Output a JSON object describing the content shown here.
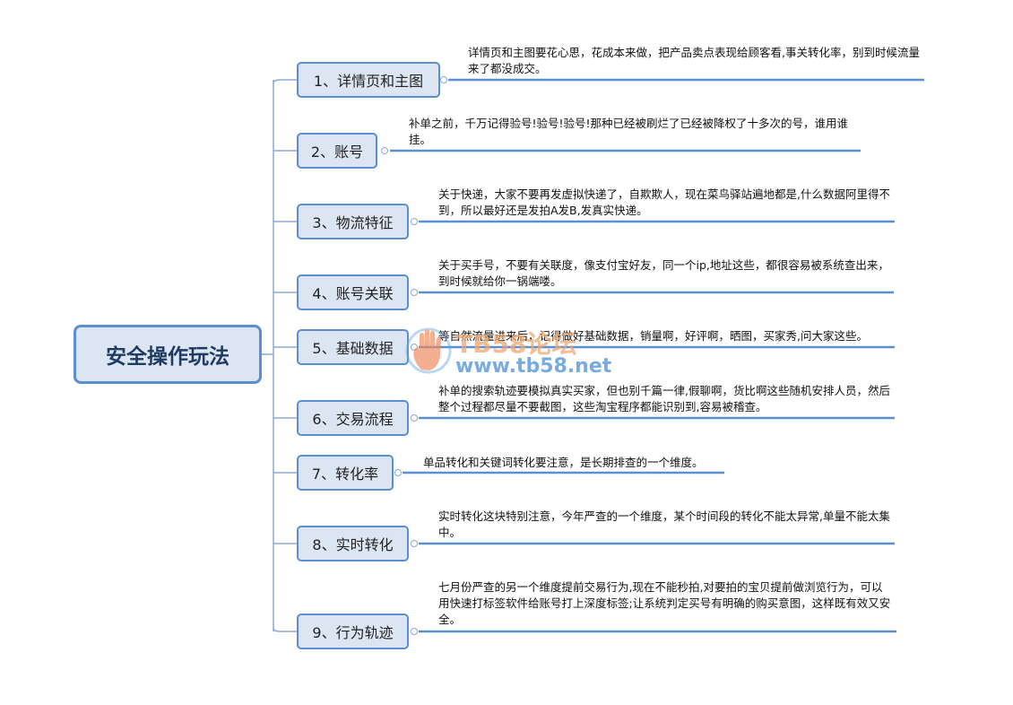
{
  "root": {
    "label": "安全操作玩法"
  },
  "branches": [
    {
      "label": "1、详情页和主图",
      "note": "详情页和主图要花心思，花成本来做，把产品卖点表现给顾客看,事关转化率，别到时候流量来了都没成交。"
    },
    {
      "label": "2、账号",
      "note": "补单之前，千万记得验号!验号!验号!那种已经被刷烂了已经被降权了十多次的号，谁用谁挂。"
    },
    {
      "label": "3、物流特征",
      "note": "关于快递，大家不要再发虚拟快递了，自欺欺人，现在菜鸟驿站遍地都是,什么数据阿里得不到，所以最好还是发拍A发B,发真实快递。"
    },
    {
      "label": "4、账号关联",
      "note": "关于买手号，不要有关联度，像支付宝好友，同一个ip,地址这些，都很容易被系统查出来，到时候就给你一锅端喽。"
    },
    {
      "label": "5、基础数据",
      "note": "等自然流量进来后，记得做好基础数据，销量啊，好评啊，晒图，买家秀,问大家这些。"
    },
    {
      "label": "6、交易流程",
      "note": "补单的搜索轨迹要模拟真实买家，但也别千篇一律,假聊啊，货比啊这些随机安排人员，然后整个过程都尽量不要截图，这些淘宝程序都能识别到,容易被稽查。"
    },
    {
      "label": "7、转化率",
      "note": "单品转化和关键词转化要注意，是长期排查的一个维度。"
    },
    {
      "label": "8、实时转化",
      "note": "实时转化这块特别注意，今年严查的一个维度，某个时间段的转化不能太异常,单量不能太集中。"
    },
    {
      "label": "9、行为轨迹",
      "note": "七月份严查的另一个维度提前交易行为,现在不能秒拍,对要拍的宝贝提前做浏览行为，可以用快速打标签软件给账号打上深度标签;让系统判定买号有明确的购买意图，这样既有效又安全。"
    }
  ],
  "watermark": {
    "brand": "TB58论坛",
    "url": "www.tb58.net",
    "icon": "hand-logo-icon"
  },
  "colors": {
    "line": "#5b8fd0",
    "node_fill": "#dce6f2",
    "root_border": "#5b8fd0"
  }
}
